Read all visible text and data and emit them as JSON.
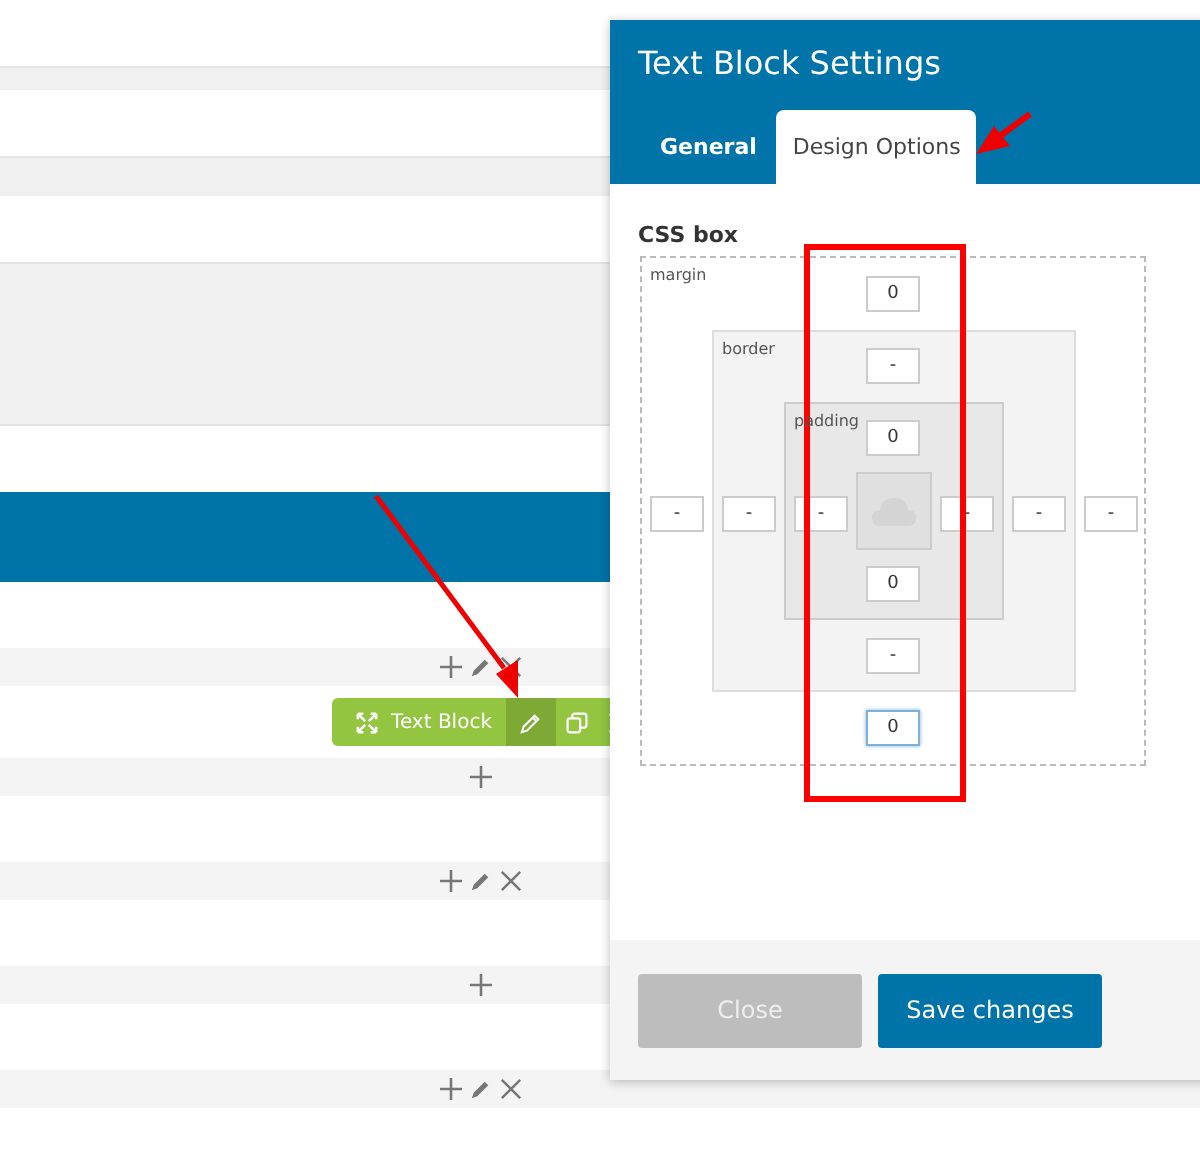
{
  "page_rows": [
    {
      "kind": "white"
    },
    {
      "kind": "strip"
    },
    {
      "kind": "white"
    },
    {
      "kind": "band"
    },
    {
      "kind": "white"
    },
    {
      "kind": "panel"
    },
    {
      "kind": "white"
    },
    {
      "kind": "header"
    },
    {
      "kind": "white"
    },
    {
      "kind": "controls",
      "edit": true
    },
    {
      "kind": "element",
      "label": "Text Block"
    },
    {
      "kind": "controls",
      "edit": false
    },
    {
      "kind": "white"
    },
    {
      "kind": "controls",
      "edit": true
    },
    {
      "kind": "white"
    },
    {
      "kind": "controls",
      "edit": false
    },
    {
      "kind": "white"
    },
    {
      "kind": "controls",
      "edit": true
    },
    {
      "kind": "white"
    }
  ],
  "dialog": {
    "title": "Text Block Settings",
    "tabs": [
      {
        "label": "General",
        "selected": false
      },
      {
        "label": "Design Options",
        "selected": true
      }
    ],
    "css_box": {
      "title": "CSS box",
      "layers": [
        {
          "label": "margin",
          "fields": [
            {
              "kind": "top",
              "value": "0",
              "focused": false
            },
            {
              "kind": "left",
              "value": "-",
              "focused": false
            },
            {
              "kind": "right",
              "value": "-",
              "focused": false
            },
            {
              "kind": "bottom",
              "value": "0",
              "focused": true
            }
          ]
        },
        {
          "label": "border",
          "fields": [
            {
              "kind": "top",
              "value": "-",
              "focused": false
            },
            {
              "kind": "left",
              "value": "-",
              "focused": false
            },
            {
              "kind": "right",
              "value": "-",
              "focused": false
            },
            {
              "kind": "bottom",
              "value": "-",
              "focused": false
            }
          ]
        },
        {
          "label": "padding",
          "fields": [
            {
              "kind": "top",
              "value": "0",
              "focused": false
            },
            {
              "kind": "left",
              "value": "-",
              "focused": false
            },
            {
              "kind": "right",
              "value": "-",
              "focused": false
            },
            {
              "kind": "bottom",
              "value": "0",
              "focused": false
            }
          ]
        }
      ]
    },
    "buttons": [
      {
        "label": "Close",
        "kind": "secondary"
      },
      {
        "label": "Save changes",
        "kind": "primary"
      }
    ]
  }
}
